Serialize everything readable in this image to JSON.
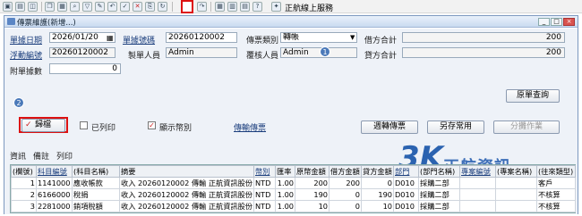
{
  "toolbar": {
    "service_label": "正航線上服務",
    "icons": [
      "save-icon",
      "print-icon",
      "preview-icon",
      "copy-icon",
      "paste-icon",
      "delete-icon",
      "edit-icon",
      "find-icon",
      "filter-icon",
      "undo-icon",
      "redo-icon",
      "approve-icon",
      "refresh-icon",
      "attach-icon",
      "calendar-icon",
      "help-icon",
      "service-icon"
    ]
  },
  "window": {
    "title": "傳票維護(新增...)"
  },
  "header": {
    "doc_date_label": "單據日期",
    "doc_date": "2026/01/20",
    "doc_no_label": "單據號碼",
    "doc_no": "20260120002",
    "voucher_type_label": "傳票類別",
    "voucher_type": "轉帳",
    "debit_total_label": "借方合計",
    "debit_total": "200",
    "float_no_label": "浮動編號",
    "float_no": "20260120002",
    "maker_label": "製單人員",
    "maker": "Admin",
    "reviewer_label": "覆核人員",
    "reviewer": "Admin",
    "credit_total_label": "貸方合計",
    "credit_total": "200",
    "attach_label": "附單據數",
    "attach_count": "0"
  },
  "badges": {
    "one": "1",
    "two": "2"
  },
  "actions": {
    "original_query": "原單查詢",
    "return_label": "歸檔",
    "printed_label": "已列印",
    "show_category_label": "顯示幣別",
    "transfer_voucher": "傳輸傳票",
    "recurring": "週轉傳票",
    "save_common": "另存常用",
    "split": "分攤作業"
  },
  "tabs": [
    "資訊",
    "備註",
    "列印"
  ],
  "grid": {
    "columns": [
      "(欄號)",
      "科目編號",
      "(科目名稱)",
      "摘要",
      "幣別",
      "匯率",
      "原幣金額",
      "借方金額",
      "貸方金額",
      "部門",
      "(部門名稱)",
      "專案編號",
      "(專案名稱)",
      "(往來類型)"
    ],
    "rows": [
      [
        "1",
        "1141000",
        "應收帳款",
        "收入 20260120002 傳輸 正航資訊股份",
        "NTD",
        "1.00",
        "200",
        "200",
        "0",
        "D010",
        "採購二部",
        "",
        "",
        "客戶"
      ],
      [
        "2",
        "6166000",
        "稅捐",
        "收入 20260120002 傳輸 正航資訊股份",
        "NTD",
        "1.00",
        "190",
        "0",
        "190",
        "D010",
        "採購二部",
        "",
        "",
        "不核算"
      ],
      [
        "3",
        "2281000",
        "銷項稅額",
        "收入 20260120002 傳輸 正航資訊股份",
        "NTD",
        "1.00",
        "10",
        "0",
        "10",
        "D010",
        "採購二部",
        "",
        "",
        "不核算"
      ]
    ]
  },
  "watermark": {
    "text": "正航資訊",
    "mark": "3K"
  }
}
